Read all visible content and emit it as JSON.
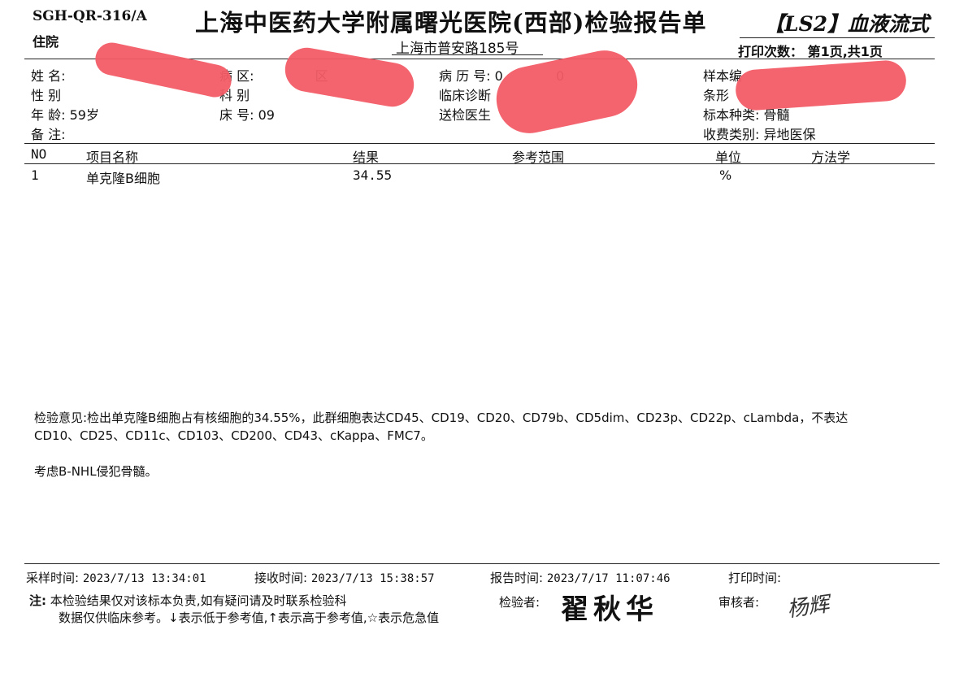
{
  "header": {
    "doc_code": "SGH-QR-316/A",
    "ward_type": "住院",
    "title": "上海中医药大学附属曙光医院(西部)检验报告单",
    "dept_tag": "【LS2】血液流式",
    "address": "上海市普安路185号",
    "print_count": "打印次数： 第1页,共1页"
  },
  "patient": {
    "name_label": "姓  名:",
    "sex_label": "性  别",
    "age_label": "年  龄:",
    "age_value": "59岁",
    "note_label": "备  注:",
    "ward_label": "病  区:",
    "ward_suffix": "区",
    "dept_label": "科  别",
    "bed_label": "床  号:",
    "bed_value": "09",
    "record_label": "病 历 号:",
    "record_partial": "0",
    "record_tail": "0",
    "diagnosis_label": "临床诊断",
    "doctor_label": "送检医生",
    "sample_no_label": "样本编",
    "barcode_label": "条形",
    "specimen_label": "标本种类:",
    "specimen_value": "骨髓",
    "fee_label": "收费类别:",
    "fee_value": "异地医保"
  },
  "table": {
    "headers": {
      "no": "NO",
      "item": "项目名称",
      "result": "结果",
      "reference": "参考范围",
      "unit": "单位",
      "method": "方法学"
    },
    "rows": [
      {
        "no": "1",
        "item": "单克隆B细胞",
        "result": "34.55",
        "reference": "",
        "unit": "%",
        "method": ""
      }
    ]
  },
  "opinion": {
    "line1": "检验意见:检出单克隆B细胞占有核细胞的34.55%，此群细胞表达CD45、CD19、CD20、CD79b、CD5dim、CD23p、CD22p、cLambda，不表达",
    "line2": "CD10、CD25、CD11c、CD103、CD200、CD43、cKappa、FMC7。",
    "line3": "考虑B-NHL侵犯骨髓。"
  },
  "footer": {
    "sample_time_label": "采样时间:",
    "sample_time": "2023/7/13 13:34:01",
    "receive_time_label": "接收时间:",
    "receive_time": "2023/7/13 15:38:57",
    "report_time_label": "报告时间:",
    "report_time": "2023/7/17 11:07:46",
    "print_time_label": "打印时间:",
    "note_label": "注:",
    "note_line1": "本检验结果仅对该标本负责,如有疑问请及时联系检验科",
    "note_line2": "数据仅供临床参考。↓表示低于参考值,↑表示高于参考值,☆表示危急值",
    "examiner_label": "检验者:",
    "examiner_name": "翟秋华",
    "reviewer_label": "审核者:",
    "reviewer_signature": "杨辉"
  },
  "colors": {
    "redaction": "#f25c67",
    "text": "#111111"
  }
}
